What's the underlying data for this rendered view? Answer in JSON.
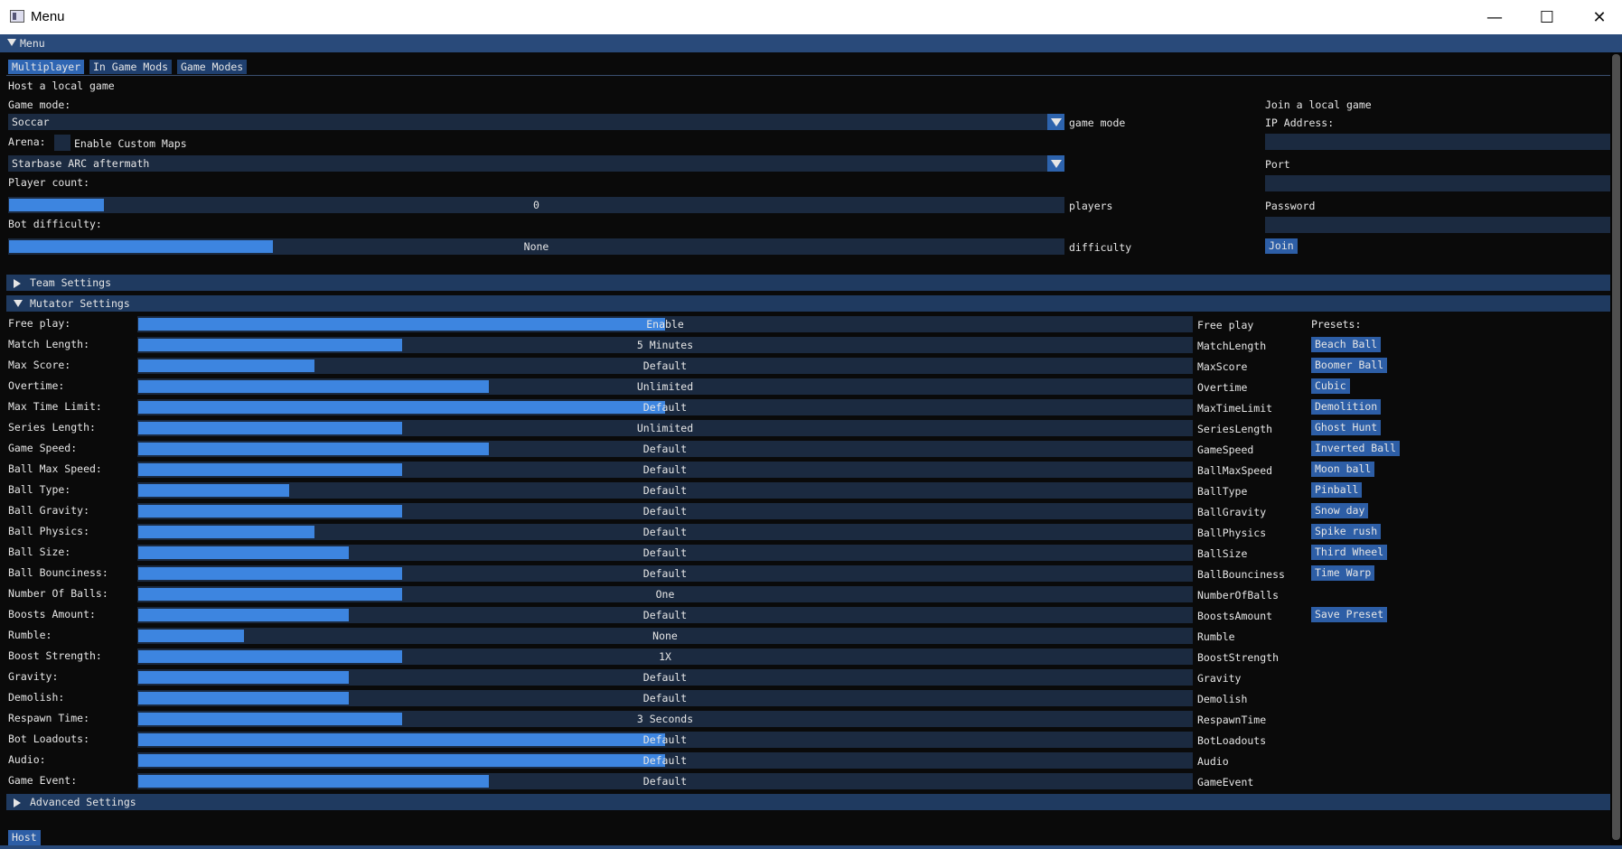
{
  "window": {
    "title": "Menu",
    "minimize_icon": "minimize-icon",
    "maximize_icon": "maximize-icon",
    "close_icon": "close-icon"
  },
  "imgui_window": {
    "title": "Menu"
  },
  "tabs": [
    "Multiplayer",
    "In Game Mods",
    "Game Modes"
  ],
  "host": {
    "heading": "Host a local game",
    "game_mode_label": "Game mode:",
    "game_mode_value": "Soccar",
    "game_mode_suffix": "game mode",
    "arena_label": "Arena:",
    "custom_maps_label": "Enable Custom Maps",
    "custom_maps_checked": false,
    "arena_value": "Starbase ARC aftermath",
    "player_count_label": "Player count:",
    "player_count_value": "0",
    "player_count_fill": 0.09,
    "player_count_suffix": "players",
    "bot_difficulty_label": "Bot difficulty:",
    "bot_difficulty_value": "None",
    "bot_difficulty_fill": 0.25,
    "bot_difficulty_suffix": "difficulty"
  },
  "join": {
    "heading": "Join a local game",
    "ip_label": "IP Address:",
    "ip_value": "",
    "port_label": "Port",
    "port_value": "",
    "password_label": "Password",
    "password_value": "",
    "join_button": "Join"
  },
  "sections": {
    "team_settings": "Team Settings",
    "mutator_settings": "Mutator Settings",
    "advanced_settings": "Advanced Settings"
  },
  "mutators": [
    {
      "label": "Free play:",
      "value": "Enable",
      "fill": 0.5,
      "suffix": "Free play"
    },
    {
      "label": "Match Length:",
      "value": "5 Minutes",
      "fill": 0.25,
      "suffix": "MatchLength"
    },
    {
      "label": "Max Score:",
      "value": "Default",
      "fill": 0.167,
      "suffix": "MaxScore"
    },
    {
      "label": "Overtime:",
      "value": "Unlimited",
      "fill": 0.333,
      "suffix": "Overtime"
    },
    {
      "label": "Max Time Limit:",
      "value": "Default",
      "fill": 0.5,
      "suffix": "MaxTimeLimit"
    },
    {
      "label": "Series Length:",
      "value": "Unlimited",
      "fill": 0.25,
      "suffix": "SeriesLength"
    },
    {
      "label": "Game Speed:",
      "value": "Default",
      "fill": 0.333,
      "suffix": "GameSpeed"
    },
    {
      "label": "Ball Max Speed:",
      "value": "Default",
      "fill": 0.25,
      "suffix": "BallMaxSpeed"
    },
    {
      "label": "Ball Type:",
      "value": "Default",
      "fill": 0.143,
      "suffix": "BallType"
    },
    {
      "label": "Ball Gravity:",
      "value": "Default",
      "fill": 0.25,
      "suffix": "BallGravity"
    },
    {
      "label": "Ball Physics:",
      "value": "Default",
      "fill": 0.167,
      "suffix": "BallPhysics"
    },
    {
      "label": "Ball Size:",
      "value": "Default",
      "fill": 0.2,
      "suffix": "BallSize"
    },
    {
      "label": "Ball Bounciness:",
      "value": "Default",
      "fill": 0.25,
      "suffix": "BallBounciness"
    },
    {
      "label": "Number Of Balls:",
      "value": "One",
      "fill": 0.25,
      "suffix": "NumberOfBalls"
    },
    {
      "label": "Boosts Amount:",
      "value": "Default",
      "fill": 0.2,
      "suffix": "BoostsAmount"
    },
    {
      "label": "Rumble:",
      "value": "None",
      "fill": 0.1,
      "suffix": "Rumble"
    },
    {
      "label": "Boost Strength:",
      "value": "1X",
      "fill": 0.25,
      "suffix": "BoostStrength"
    },
    {
      "label": "Gravity:",
      "value": "Default",
      "fill": 0.2,
      "suffix": "Gravity"
    },
    {
      "label": "Demolish:",
      "value": "Default",
      "fill": 0.2,
      "suffix": "Demolish"
    },
    {
      "label": "Respawn Time:",
      "value": "3 Seconds",
      "fill": 0.25,
      "suffix": "RespawnTime"
    },
    {
      "label": "Bot Loadouts:",
      "value": "Default",
      "fill": 0.5,
      "suffix": "BotLoadouts"
    },
    {
      "label": "Audio:",
      "value": "Default",
      "fill": 0.5,
      "suffix": "Audio"
    },
    {
      "label": "Game Event:",
      "value": "Default",
      "fill": 0.333,
      "suffix": "GameEvent"
    }
  ],
  "presets": {
    "label": "Presets:",
    "items": [
      "Beach Ball",
      "Boomer Ball",
      "Cubic",
      "Demolition",
      "Ghost Hunt",
      "Inverted Ball",
      "Moon ball",
      "Pinball",
      "Snow day",
      "Spike rush",
      "Third Wheel",
      "Time Warp"
    ],
    "save_button": "Save Preset"
  },
  "host_button": "Host",
  "colors": {
    "titlebar": "#294a7a",
    "slider_fill": "#3d85e0",
    "frame_bg": "#1b2a40",
    "button": "#2d5ea6",
    "header": "#1f3a60"
  }
}
